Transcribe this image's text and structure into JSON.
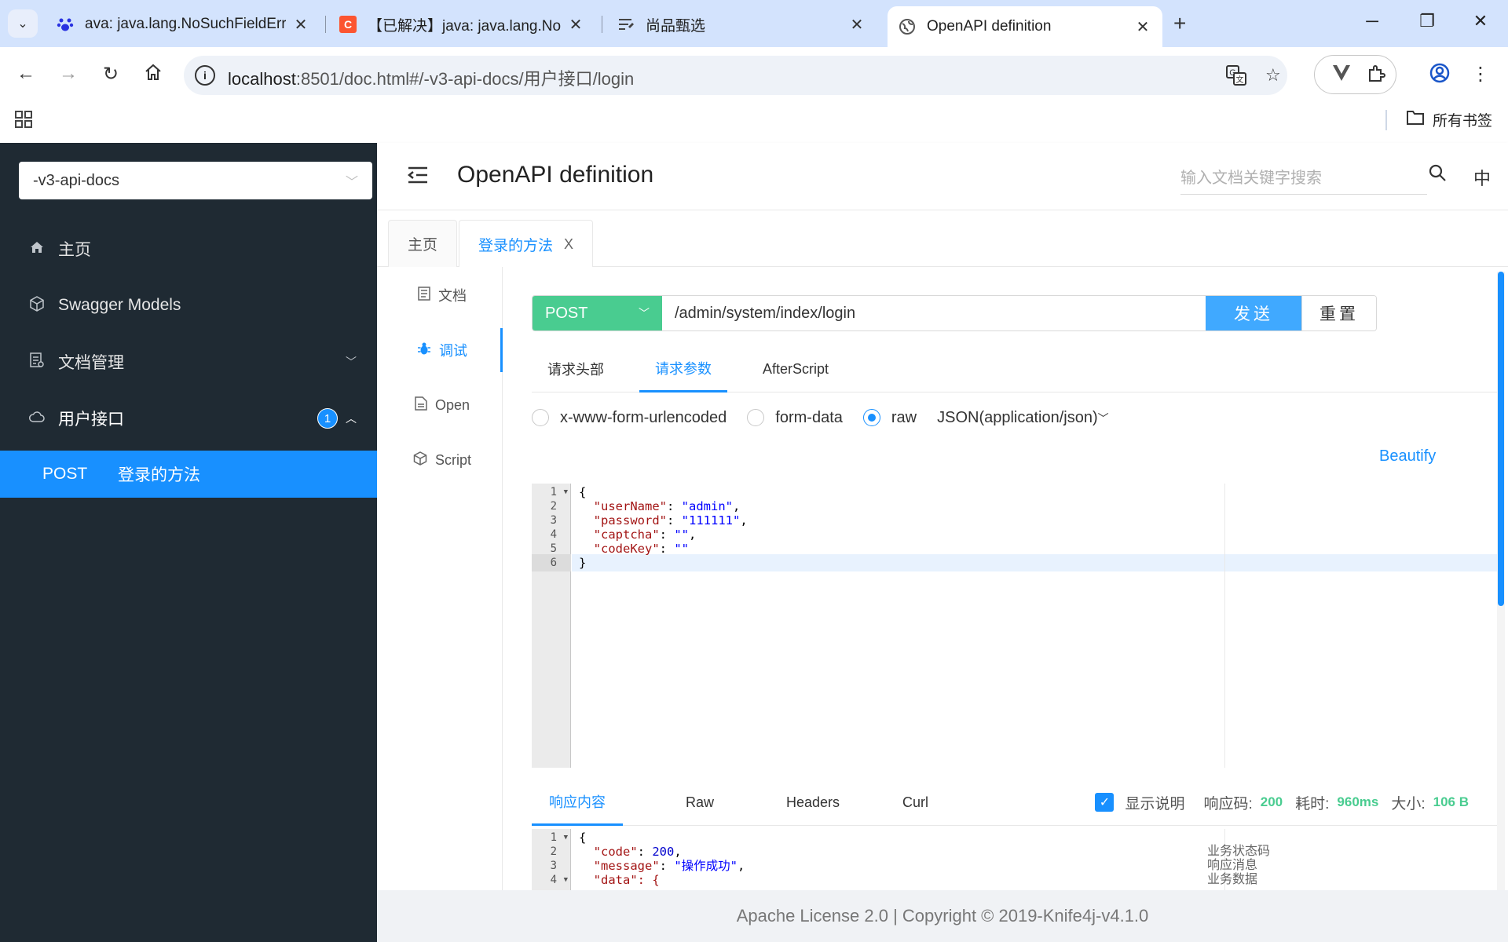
{
  "browser": {
    "tabs": [
      {
        "title": "ava: java.lang.NoSuchFieldErr",
        "icon": "baidu-paw-icon"
      },
      {
        "title": "【已解决】java: java.lang.NoS",
        "icon": "csdn-c-icon"
      },
      {
        "title": "尚品甄选",
        "icon": "document-lines-icon"
      },
      {
        "title": "OpenAPI definition",
        "icon": "globe-icon"
      }
    ],
    "new_tab": "+",
    "url_host": "localhost",
    "url_path": ":8501/doc.html#/-v3-api-docs/用户接口/login",
    "bookmarks_folder": "所有书签"
  },
  "sidebar": {
    "group_select": "-v3-api-docs",
    "items": [
      {
        "label": "主页",
        "icon": "home-icon"
      },
      {
        "label": "Swagger Models",
        "icon": "cube-icon"
      },
      {
        "label": "文档管理",
        "icon": "doc-manage-icon"
      },
      {
        "label": "用户接口",
        "icon": "cloud-icon",
        "badge": "1"
      }
    ],
    "sub_item": {
      "method": "POST",
      "label": "登录的方法"
    }
  },
  "header": {
    "title": "OpenAPI definition",
    "search_placeholder": "输入文档关键字搜索",
    "lang": "中"
  },
  "doc_tabs": [
    {
      "label": "主页"
    },
    {
      "label": "登录的方法",
      "close": "X"
    }
  ],
  "vtabs": [
    {
      "label": "文档"
    },
    {
      "label": "调试"
    },
    {
      "label": "Open"
    },
    {
      "label": "Script"
    }
  ],
  "request": {
    "method": "POST",
    "url": "/admin/system/index/login",
    "send": "发送",
    "reset": "重置"
  },
  "request_tabs": [
    "请求头部",
    "请求参数",
    "AfterScript"
  ],
  "body_types": [
    "x-www-form-urlencoded",
    "form-data",
    "raw"
  ],
  "content_type": "JSON(application/json)",
  "beautify": "Beautify",
  "request_body": {
    "line_numbers": [
      "1",
      "2",
      "3",
      "4",
      "5",
      "6"
    ],
    "lines": [
      {
        "open": "{"
      },
      {
        "key": "\"userName\"",
        "sep": ": ",
        "val": "\"admin\"",
        "end": ","
      },
      {
        "key": "\"password\"",
        "sep": ": ",
        "val": "\"111111\"",
        "end": ","
      },
      {
        "key": "\"captcha\"",
        "sep": ": ",
        "val": "\"\"",
        "end": ","
      },
      {
        "key": "\"codeKey\"",
        "sep": ": ",
        "val": "\"\"",
        "end": ""
      },
      {
        "open": "}"
      }
    ]
  },
  "response_tabs": [
    "响应内容",
    "Raw",
    "Headers",
    "Curl"
  ],
  "response_meta": {
    "show_desc": "显示说明",
    "code_label": "响应码:",
    "code": "200",
    "time_label": "耗时:",
    "time": "960ms",
    "size_label": "大小:",
    "size": "106 B"
  },
  "response_body": {
    "line_numbers": [
      "1",
      "2",
      "3",
      "4"
    ],
    "l1": "{",
    "l2_key": "\"code\"",
    "l2_val": "200",
    "l3_key": "\"message\"",
    "l3_val": "\"操作成功\"",
    "l4": "\"data\": {",
    "descriptions": [
      "业务状态码",
      "响应消息",
      "业务数据"
    ]
  },
  "footer": "Apache License 2.0 | Copyright © 2019-Knife4j-v4.1.0",
  "colors": {
    "accent": "#1890ff",
    "post_green": "#49cc90",
    "sidebar_bg": "#1f2a33",
    "tabstrip_bg": "#d3e3fd"
  }
}
